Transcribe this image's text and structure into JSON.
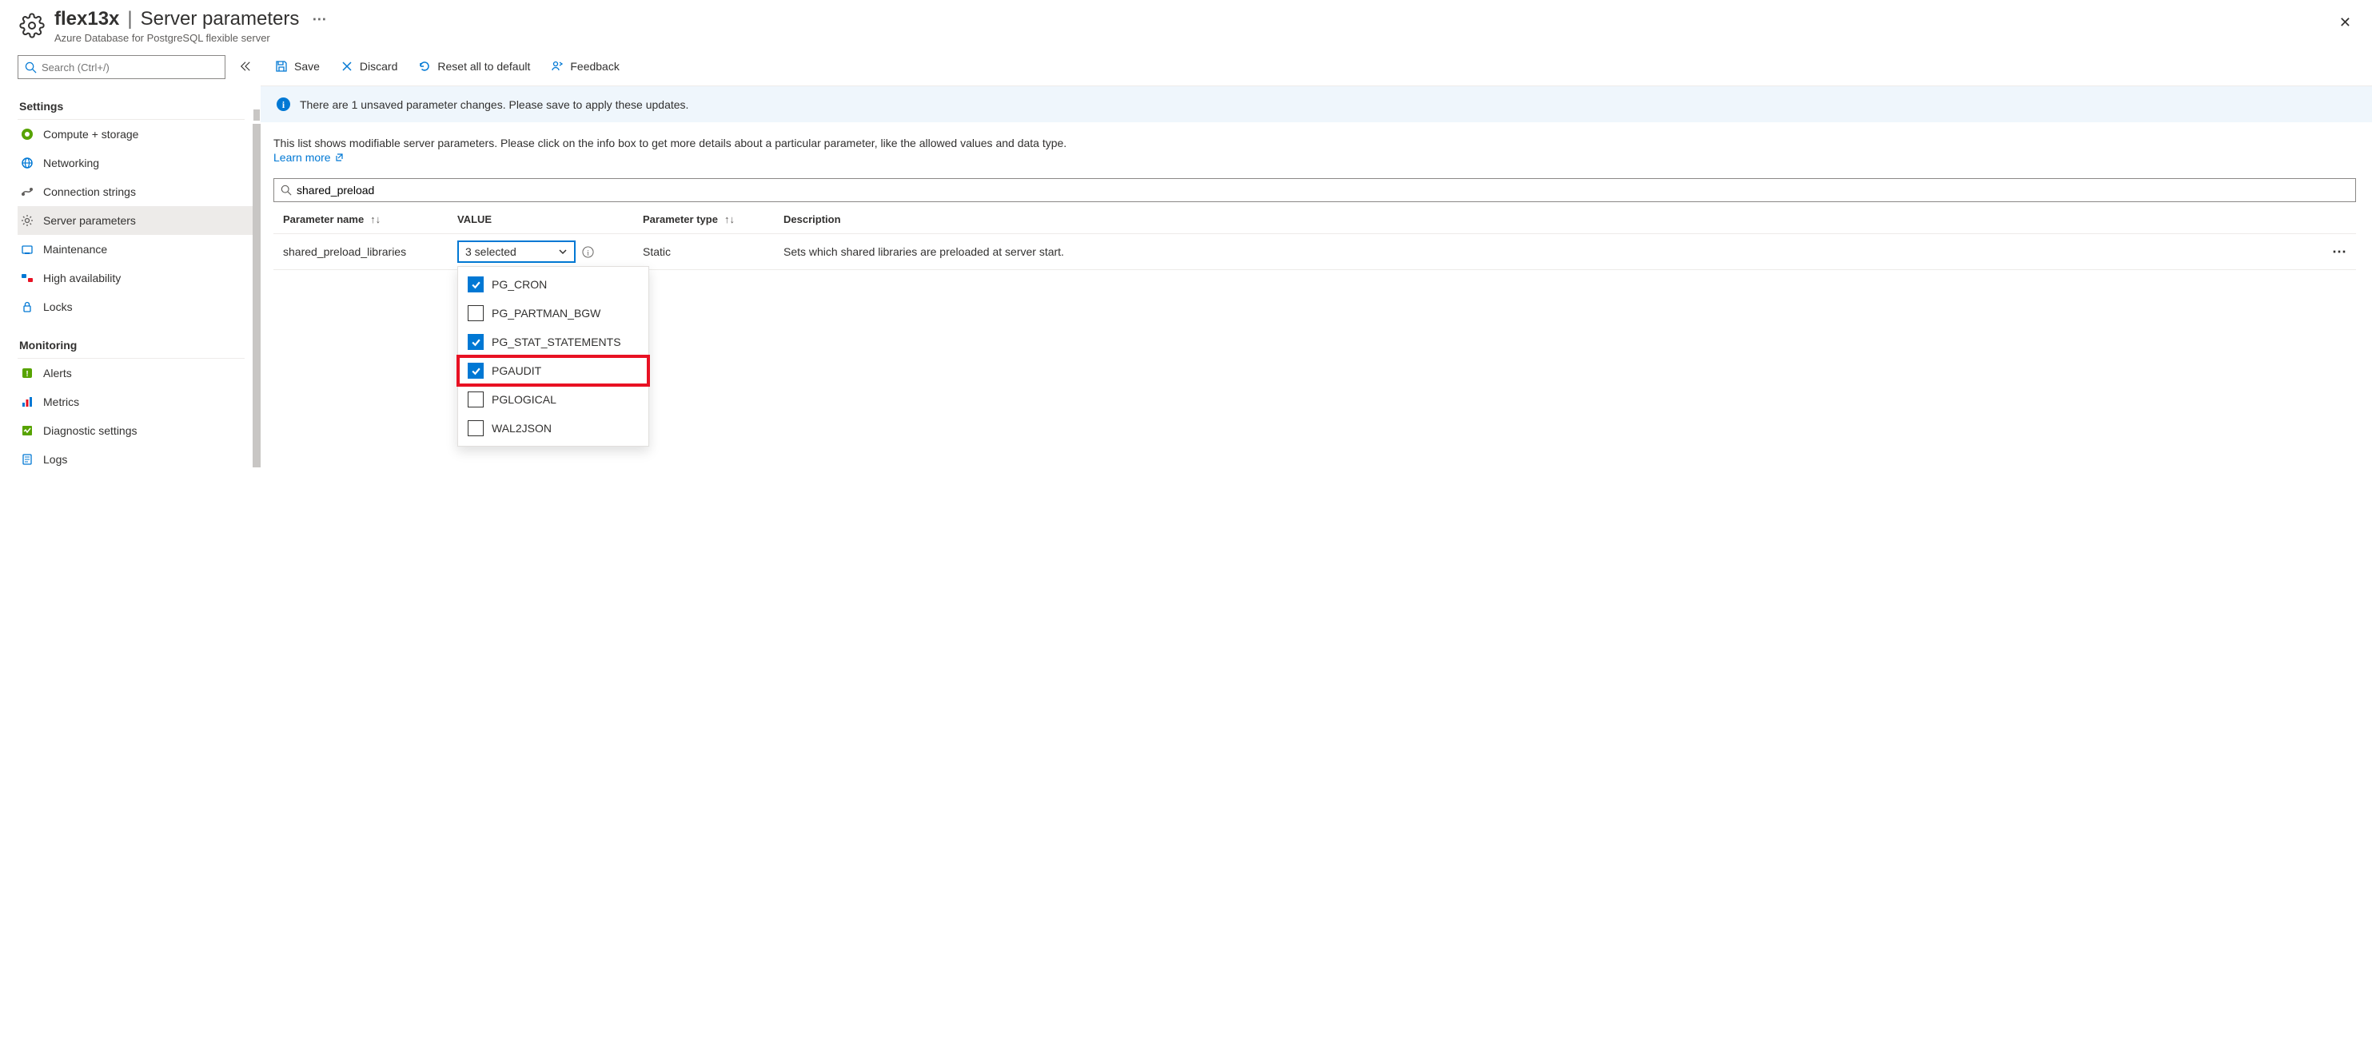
{
  "header": {
    "server_name": "flex13x",
    "page_name": "Server parameters",
    "subtitle": "Azure Database for PostgreSQL flexible server"
  },
  "sidebar": {
    "search_placeholder": "Search (Ctrl+/)",
    "sections": {
      "settings": {
        "title": "Settings",
        "items": [
          {
            "label": "Compute + storage"
          },
          {
            "label": "Networking"
          },
          {
            "label": "Connection strings"
          },
          {
            "label": "Server parameters"
          },
          {
            "label": "Maintenance"
          },
          {
            "label": "High availability"
          },
          {
            "label": "Locks"
          }
        ]
      },
      "monitoring": {
        "title": "Monitoring",
        "items": [
          {
            "label": "Alerts"
          },
          {
            "label": "Metrics"
          },
          {
            "label": "Diagnostic settings"
          },
          {
            "label": "Logs"
          }
        ]
      }
    }
  },
  "toolbar": {
    "save": "Save",
    "discard": "Discard",
    "reset": "Reset all to default",
    "feedback": "Feedback"
  },
  "banner": {
    "text": "There are 1 unsaved parameter changes.  Please save to apply these updates."
  },
  "main": {
    "description": "This list shows modifiable server parameters. Please click on the info box to get more details about a particular parameter, like the allowed values and data type.",
    "learn_more": "Learn more",
    "search_value": "shared_preload"
  },
  "table": {
    "headers": {
      "name": "Parameter name",
      "value": "VALUE",
      "type": "Parameter type",
      "desc": "Description"
    },
    "row": {
      "name": "shared_preload_libraries",
      "value_display": "3 selected",
      "type": "Static",
      "desc": "Sets which shared libraries are preloaded at server start."
    }
  },
  "dropdown": {
    "options": [
      {
        "label": "PG_CRON",
        "checked": true,
        "highlight": false
      },
      {
        "label": "PG_PARTMAN_BGW",
        "checked": false,
        "highlight": false
      },
      {
        "label": "PG_STAT_STATEMENTS",
        "checked": true,
        "highlight": false
      },
      {
        "label": "PGAUDIT",
        "checked": true,
        "highlight": true
      },
      {
        "label": "PGLOGICAL",
        "checked": false,
        "highlight": false
      },
      {
        "label": "WAL2JSON",
        "checked": false,
        "highlight": false
      }
    ]
  }
}
